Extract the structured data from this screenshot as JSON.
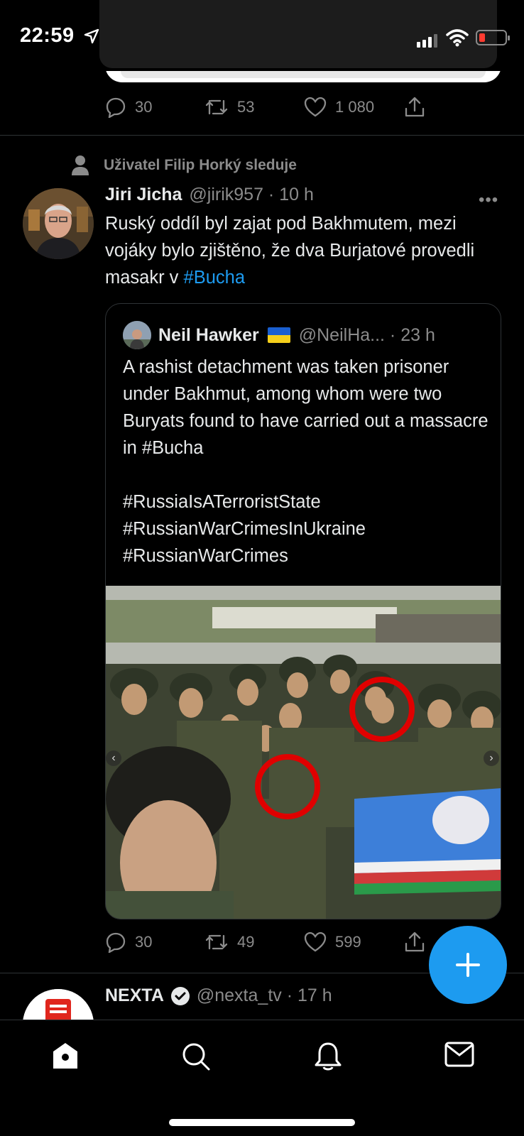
{
  "status_bar": {
    "time": "22:59"
  },
  "prev_tweet_actions": {
    "replies": "30",
    "retweets": "53",
    "likes": "1 080"
  },
  "tweet": {
    "social_context": "Uživatel Filip Horký sleduje",
    "author_name": "Jiri Jicha",
    "handle_time": "@jirik957 · 10 h",
    "text_main": "Ruský oddíl byl zajat pod Bakhmutem, mezi vojáky bylo zjištěno, že dva Burjatové provedli masakr v ",
    "text_hashtag": "#Bucha",
    "more": "•••",
    "quote": {
      "author_name": "Neil Hawker",
      "handle_time": "@NeilHa... · 23 h",
      "text": "A rashist detachment was taken prisoner under Bakhmut, among whom were two Buryats found to have carried out a massacre in #Bucha\n\n#RussiaIsATerroristState\n#RussianWarCrimesInUkraine\n#RussianWarCrimes"
    },
    "actions": {
      "replies": "30",
      "retweets": "49",
      "likes": "599"
    }
  },
  "next_tweet": {
    "author_name": "NEXTA",
    "handle_time": "@nexta_tv · 17 h"
  },
  "colors": {
    "accent": "#1d9bf0",
    "background": "#000000",
    "muted": "#8b8b8b"
  },
  "icons": [
    "home-icon",
    "search-icon",
    "bell-icon",
    "mail-icon",
    "compose-icon"
  ]
}
